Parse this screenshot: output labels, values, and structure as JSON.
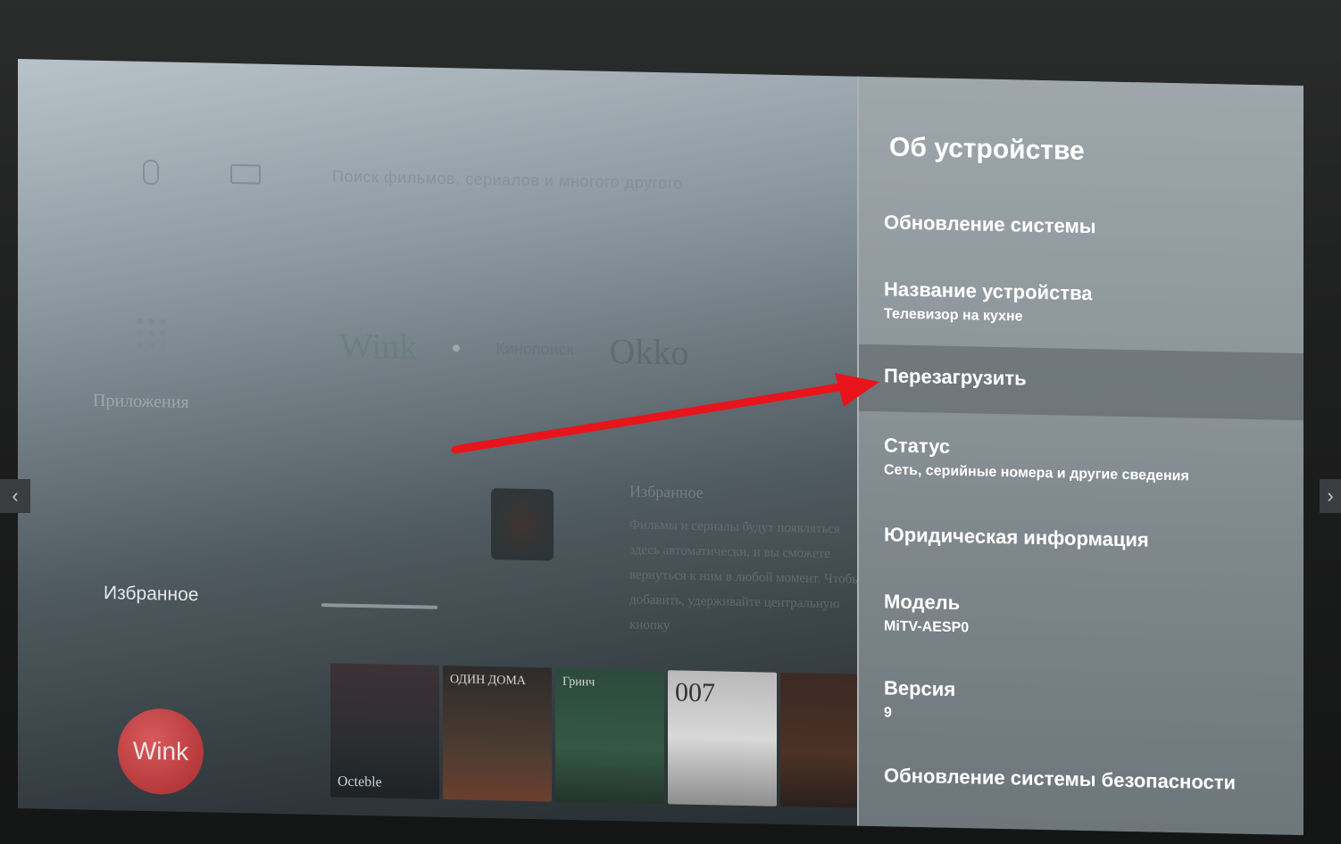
{
  "home": {
    "search_hint": "Поиск фильмов, сериалов и многого другого",
    "apps_label": "Приложения",
    "favorites_label": "Избранное",
    "channels": {
      "wink": "Wink",
      "middle": "Кинопоиск",
      "right": "Okko"
    },
    "favorites_section": {
      "title": "Избранное",
      "description": "Фильмы и сериалы будут появляться здесь автоматически, и вы сможете вернуться к ним в любой момент. Чтобы добавить, удерживайте центральную кнопку"
    },
    "posters": [
      {
        "top": "",
        "title": "Octeble"
      },
      {
        "top": "ОДИН ДОМА",
        "title": ""
      },
      {
        "top": "Гринч",
        "title": ""
      },
      {
        "top": "007",
        "title": ""
      },
      {
        "top": "",
        "title": ""
      }
    ],
    "wink_app_label": "Wink"
  },
  "settings": {
    "title": "Об устройстве",
    "items": [
      {
        "label": "Обновление системы",
        "sub": ""
      },
      {
        "label": "Название устройства",
        "sub": "Телевизор на кухне"
      },
      {
        "label": "Перезагрузить",
        "sub": ""
      },
      {
        "label": "Статус",
        "sub": "Сеть, серийные номера и другие сведения"
      },
      {
        "label": "Юридическая информация",
        "sub": ""
      },
      {
        "label": "Модель",
        "sub": "MiTV-AESP0"
      },
      {
        "label": "Версия",
        "sub": "9"
      },
      {
        "label": "Обновление системы безопасности",
        "sub": ""
      }
    ]
  },
  "viewer": {
    "prev_icon": "chevron-left-icon",
    "next_icon": "chevron-right-icon",
    "prev_glyph": "‹",
    "next_glyph": "›"
  },
  "colors": {
    "annotation_arrow": "#e8141c",
    "wink_brand": "#c13f42"
  }
}
